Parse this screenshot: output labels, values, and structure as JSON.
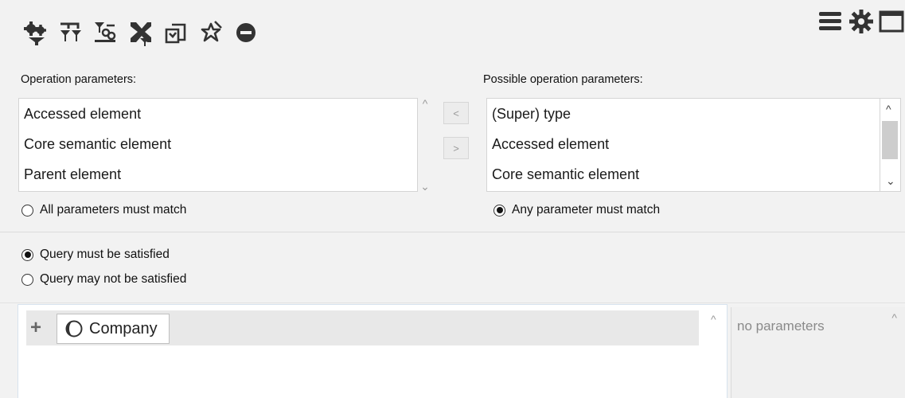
{
  "toolbar": {
    "icons": [
      "gears-filter-icon",
      "filter-branch-icon",
      "link-filter-icon",
      "tools-filter-icon",
      "copy-icon",
      "pin-icon",
      "remove-icon"
    ]
  },
  "view_icons": [
    "menu-icon",
    "settings-icon",
    "window-icon"
  ],
  "operation_parameters": {
    "label": "Operation parameters:",
    "items": [
      "Accessed element",
      "Core semantic element",
      "Parent element"
    ]
  },
  "possible_parameters": {
    "label": "Possible operation parameters:",
    "items": [
      "(Super) type",
      "Accessed element",
      "Core semantic element"
    ]
  },
  "move_buttons": {
    "left": "<",
    "right": ">"
  },
  "match": {
    "all_label": "All parameters must match",
    "all_selected": false,
    "any_label": "Any parameter must match",
    "any_selected": true
  },
  "query": {
    "satisfied_label": "Query must be satisfied",
    "satisfied_selected": true,
    "not_satisfied_label": "Query may not be satisfied",
    "not_satisfied_selected": false
  },
  "query_tree": {
    "add_symbol": "+",
    "node_label": "Company"
  },
  "parameters_panel": {
    "text": "no parameters"
  },
  "colors": {
    "icon": "#333333",
    "background": "#f2f2f2",
    "listbox": "#ffffff"
  }
}
